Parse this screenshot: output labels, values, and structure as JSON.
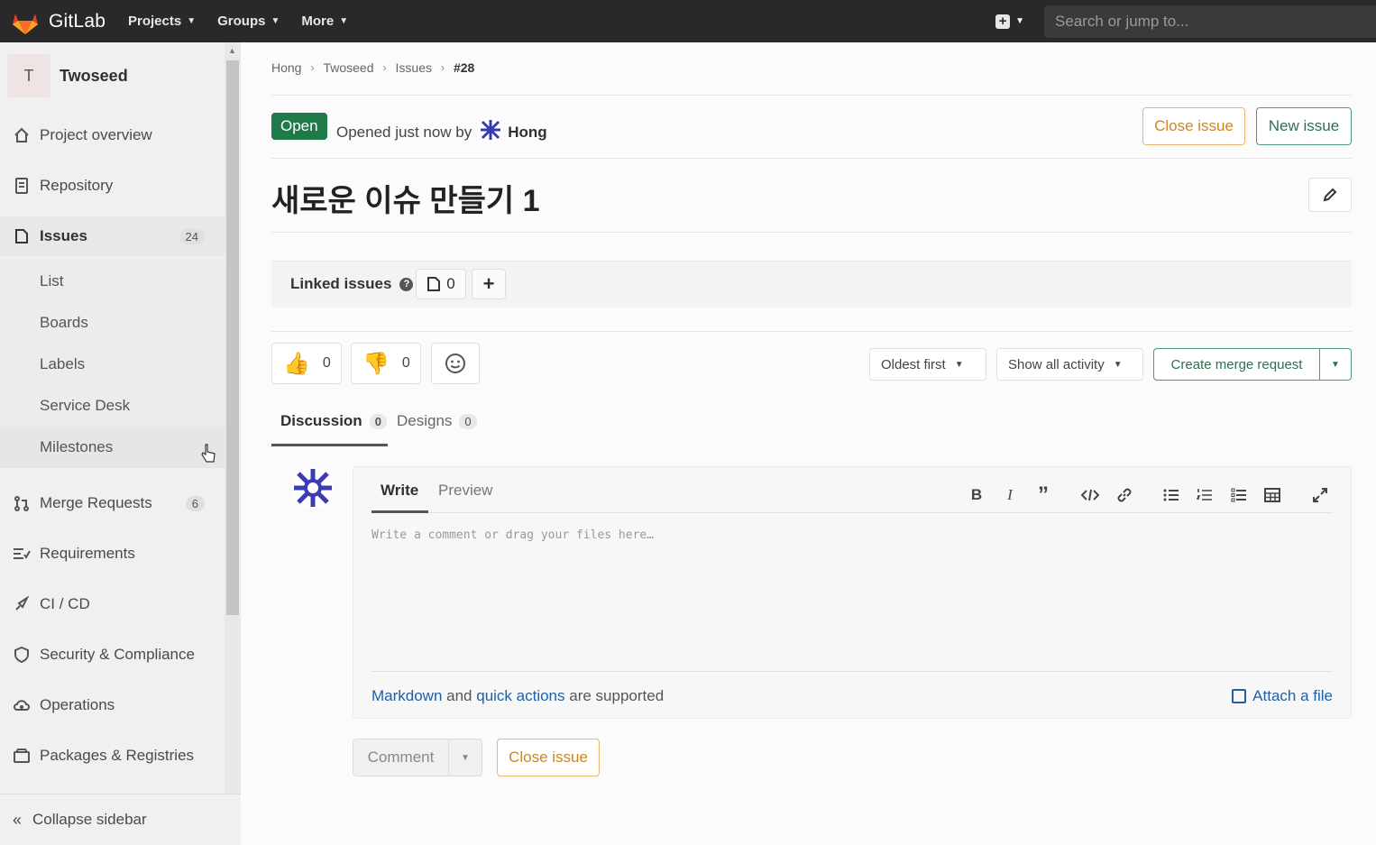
{
  "topbar": {
    "brand": "GitLab",
    "nav": [
      {
        "label": "Projects"
      },
      {
        "label": "Groups"
      },
      {
        "label": "More"
      }
    ],
    "search_placeholder": "Search or jump to..."
  },
  "sidebar": {
    "project_initial": "T",
    "project_name": "Twoseed",
    "items": [
      {
        "label": "Project overview",
        "icon": "home-icon"
      },
      {
        "label": "Repository",
        "icon": "document-icon"
      },
      {
        "label": "Issues",
        "icon": "issues-icon",
        "count": "24",
        "active": true
      },
      {
        "label": "Merge Requests",
        "icon": "merge-request-icon",
        "count": "6"
      },
      {
        "label": "Requirements",
        "icon": "requirements-icon"
      },
      {
        "label": "CI / CD",
        "icon": "rocket-icon"
      },
      {
        "label": "Security & Compliance",
        "icon": "shield-icon"
      },
      {
        "label": "Operations",
        "icon": "cloud-gear-icon"
      },
      {
        "label": "Packages & Registries",
        "icon": "package-icon"
      }
    ],
    "issue_subitems": [
      "List",
      "Boards",
      "Labels",
      "Service Desk",
      "Milestones"
    ],
    "collapse_label": "Collapse sidebar"
  },
  "breadcrumb": [
    "Hong",
    "Twoseed",
    "Issues",
    "#28"
  ],
  "issue": {
    "status": "Open",
    "opened_text": "Opened just now by",
    "author": "Hong",
    "close_label": "Close issue",
    "new_label": "New issue",
    "title": "새로운 이슈 만들기 1"
  },
  "linked_issues": {
    "title": "Linked issues",
    "count": "0"
  },
  "awards": {
    "thumbs_up": "0",
    "thumbs_down": "0"
  },
  "controls": {
    "sort": "Oldest first",
    "filter": "Show all activity",
    "create_mr": "Create merge request"
  },
  "tabs": [
    {
      "label": "Discussion",
      "count": "0"
    },
    {
      "label": "Designs",
      "count": "0"
    }
  ],
  "editor": {
    "write": "Write",
    "preview": "Preview",
    "placeholder": "Write a comment or drag your files here…",
    "footer_link1": "Markdown",
    "footer_and": " and ",
    "footer_link2": "quick actions",
    "footer_suffix": " are supported",
    "attach": "Attach a file"
  },
  "actions": {
    "comment": "Comment",
    "close_issue": "Close issue"
  },
  "colors": {
    "topbar": "#292929",
    "open_badge": "#1f7a4a",
    "warning_outline": "#e9b66b",
    "success_outline": "#4c9b74",
    "link": "#1f5fa8"
  }
}
